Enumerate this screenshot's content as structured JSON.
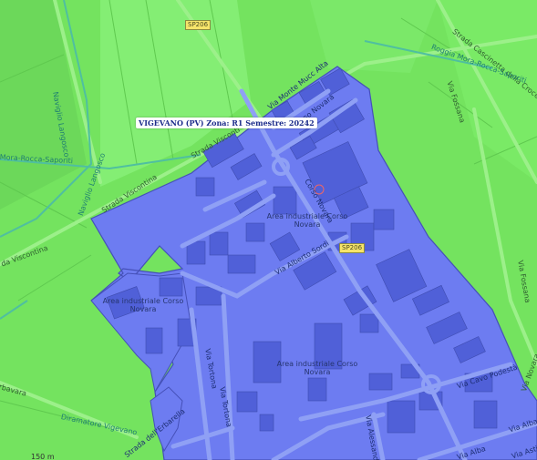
{
  "colors": {
    "land": "#74e35f",
    "field_light": "#84ee74",
    "zone_fill": "#6d7cf1",
    "zone_border": "#4550b8",
    "road": "#8fa0f5",
    "water": "#59c7a1"
  },
  "zone_label": "VIGEVANO (PV) Zona: R1 Semestre: 20242",
  "shields": {
    "sp206_top": "SP206",
    "sp206_mid": "SP206"
  },
  "roads": {
    "strada_cascinetta": "Strada Cascinetta della Croce",
    "roggia_mora": "Roggia Mora-Rocca-Saporiti",
    "via_fossana_top": "Via Fossana",
    "via_fossana_right": "Via Fossana",
    "via_moncucco": "Via Monte Mucc Alta",
    "corso_novara_1": "Corso Novara",
    "corso_novara_2": "Corso Novara",
    "strada_visconti_top": "Strada Visconti",
    "strada_viscontina": "Strada Viscontina",
    "viscontina_left": "da Viscontina",
    "naviglio_1": "Naviglio Langosco",
    "naviglio_2": "Naviglio Langosco",
    "roggia_left": "Mora-Rocca-Saporiti",
    "via_alberto_sordi": "Via Alberto Sordi",
    "via_tortona_1": "Via Tortona",
    "via_tortona_2": "Via Tortona",
    "via_cavo_podesta": "Via Cavo Podestà",
    "via_alessandria": "Via Alessandria",
    "via_alba": "Via Alba",
    "via_alba_2": "Via Alba",
    "strada_erbarella": "Strada dell'Erbarella",
    "via_asti": "Via Asti",
    "diramatore": "Diramatore Vigevano",
    "erbavara": "rbavara",
    "via_novara_right": "Via Novara"
  },
  "areas": {
    "a1": "Area industriale Corso Novara",
    "a2": "Area industriale Corso Novara",
    "a3": "Area industriale Corso Novara"
  },
  "scale_text": "150 m"
}
